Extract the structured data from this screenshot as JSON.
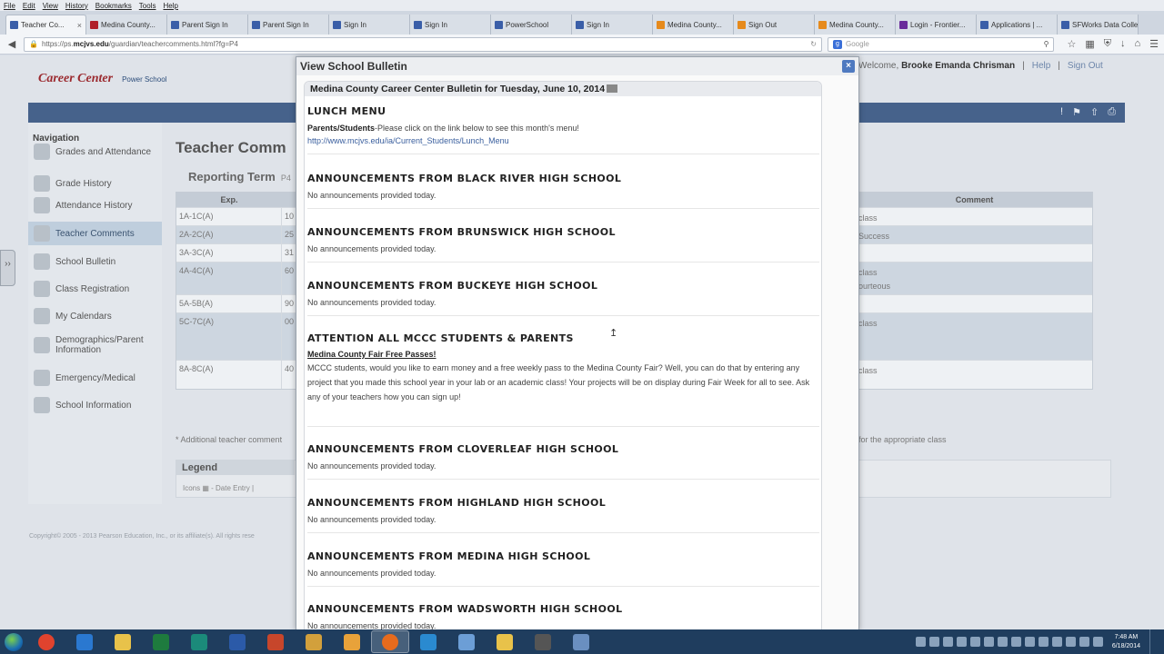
{
  "browser": {
    "menu": [
      "File",
      "Edit",
      "View",
      "History",
      "Bookmarks",
      "Tools",
      "Help"
    ],
    "tabs": [
      {
        "label": "Teacher Co...",
        "color": "blue"
      },
      {
        "label": "Medina County...",
        "color": "red"
      },
      {
        "label": "Parent Sign In",
        "color": "blue"
      },
      {
        "label": "Parent Sign In",
        "color": "blue"
      },
      {
        "label": "Sign In",
        "color": "blue"
      },
      {
        "label": "Sign In",
        "color": "blue"
      },
      {
        "label": "PowerSchool",
        "color": "blue"
      },
      {
        "label": "Sign In",
        "color": "blue"
      },
      {
        "label": "Medina County...",
        "color": "orange"
      },
      {
        "label": "Sign Out",
        "color": "orange"
      },
      {
        "label": "Medina County...",
        "color": "orange"
      },
      {
        "label": "Login - Frontier...",
        "color": "purple"
      },
      {
        "label": "Applications | ...",
        "color": "blue"
      },
      {
        "label": "SFWorks Data Colle...",
        "color": "blue"
      }
    ],
    "url_prefix": "https://ps.",
    "url_host": "mcjvs.edu",
    "url_path": "/guardian/teachercomments.html?fg=P4",
    "search_placeholder": "Google"
  },
  "page": {
    "logo_text": "Career Center",
    "logo_sub": "Power School",
    "user_prefix": "Welcome,",
    "user_name": "Brooke Emanda Chrisman",
    "help": "Help",
    "sign_out": "Sign Out",
    "nav_heading": "Navigation",
    "nav": [
      {
        "label": "Grades and Attendance",
        "icon": "grades-icon"
      },
      {
        "label": "Grade History",
        "icon": "history-icon"
      },
      {
        "label": "Attendance History",
        "icon": "attendance-icon"
      },
      {
        "label": "Teacher Comments",
        "icon": "comments-icon"
      },
      {
        "label": "School Bulletin",
        "icon": "bulletin-icon"
      },
      {
        "label": "Class Registration",
        "icon": "registration-icon"
      },
      {
        "label": "My Calendars",
        "icon": "calendar-icon"
      },
      {
        "label": "Demographics/Parent Information",
        "icon": "demographics-icon"
      },
      {
        "label": "Emergency/Medical",
        "icon": "medical-icon"
      },
      {
        "label": "School Information",
        "icon": "school-icon"
      }
    ],
    "title": "Teacher Comm",
    "reporting_term": "Reporting Term",
    "reporting_term_value": "P4",
    "table_headers": {
      "exp": "Exp.",
      "comment": "Comment"
    },
    "rows": [
      {
        "exp": "1A-1C(A)",
        "num": "10",
        "comment": "class"
      },
      {
        "exp": "2A-2C(A)",
        "num": "25",
        "comment": "Success"
      },
      {
        "exp": "3A-3C(A)",
        "num": "31",
        "comment": ""
      },
      {
        "exp": "4A-4C(A)",
        "num": "60",
        "comment": "class\nourteous"
      },
      {
        "exp": "5A-5B(A)",
        "num": "90",
        "comment": ""
      },
      {
        "exp": "5C-7C(A)",
        "num": "00",
        "comment": "class"
      },
      {
        "exp": "8A-8C(A)",
        "num": "40",
        "comment": "class"
      }
    ],
    "footnote": "* Additional teacher comment",
    "footnote_right": "for the appropriate class",
    "legend_title": "Legend",
    "legend_text": "Icons ▦ - Date Entry |",
    "copyright": "Copyright© 2005 - 2013 Pearson Education, Inc., or its affiliate(s). All rights rese"
  },
  "modal": {
    "title": "View School Bulletin",
    "close": "×",
    "bulletin_header": "Medina County Career Center Bulletin for Tuesday, June 10, 2014",
    "sections": [
      {
        "title": "LUNCH MENU",
        "lead": "Parents/Students",
        "text": "-Please click on the link below to see this month's menu!",
        "link": "http://www.mcjvs.edu/ia/Current_Students/Lunch_Menu"
      },
      {
        "title": "ANNOUNCEMENTS FROM BLACK RIVER HIGH SCHOOL",
        "text": "No announcements provided today."
      },
      {
        "title": "ANNOUNCEMENTS FROM BRUNSWICK HIGH SCHOOL",
        "text": "No announcements provided today."
      },
      {
        "title": "ANNOUNCEMENTS FROM BUCKEYE HIGH SCHOOL",
        "text": "No announcements provided today."
      },
      {
        "title": "ATTENTION ALL MCCC STUDENTS & PARENTS",
        "subtitle": "Medina County Fair Free Passes!",
        "text": "MCCC students, would you like to earn money and a free weekly pass to the Medina County Fair? Well, you can do that by entering any project that you made this school year in your lab or an academic class! Your projects will be on display during Fair Week for all to see. Ask any of your teachers how you can sign up!"
      },
      {
        "title": "ANNOUNCEMENTS FROM CLOVERLEAF HIGH SCHOOL",
        "text": "No announcements provided today."
      },
      {
        "title": "ANNOUNCEMENTS FROM HIGHLAND HIGH SCHOOL",
        "text": "No announcements provided today."
      },
      {
        "title": "ANNOUNCEMENTS FROM MEDINA HIGH SCHOOL",
        "text": "No announcements provided today."
      },
      {
        "title": "ANNOUNCEMENTS FROM WADSWORTH HIGH SCHOOL",
        "text": "No announcements provided today."
      }
    ]
  },
  "taskbar": {
    "apps": [
      "chrome-icon",
      "ie-icon",
      "explorer-icon",
      "excel-icon",
      "publisher-icon",
      "word-icon",
      "powerpoint-icon",
      "media-icon",
      "outlook-icon",
      "firefox-icon",
      "app-icon",
      "notes-icon",
      "folder-icon",
      "chat-icon",
      "network-icon"
    ],
    "app_colors": [
      "#e0432e",
      "#2a78d0",
      "#e8c24a",
      "#1e7b3e",
      "#1b8a7a",
      "#2b5aa8",
      "#c7462b",
      "#d2a03c",
      "#e8a23a",
      "#e76b1d",
      "#2a8ad0",
      "#6c9ed6",
      "#e8c24a",
      "#555",
      "#6a8fc0"
    ],
    "active_index": 9,
    "time": "7:48 AM",
    "date": "6/18/2014"
  }
}
